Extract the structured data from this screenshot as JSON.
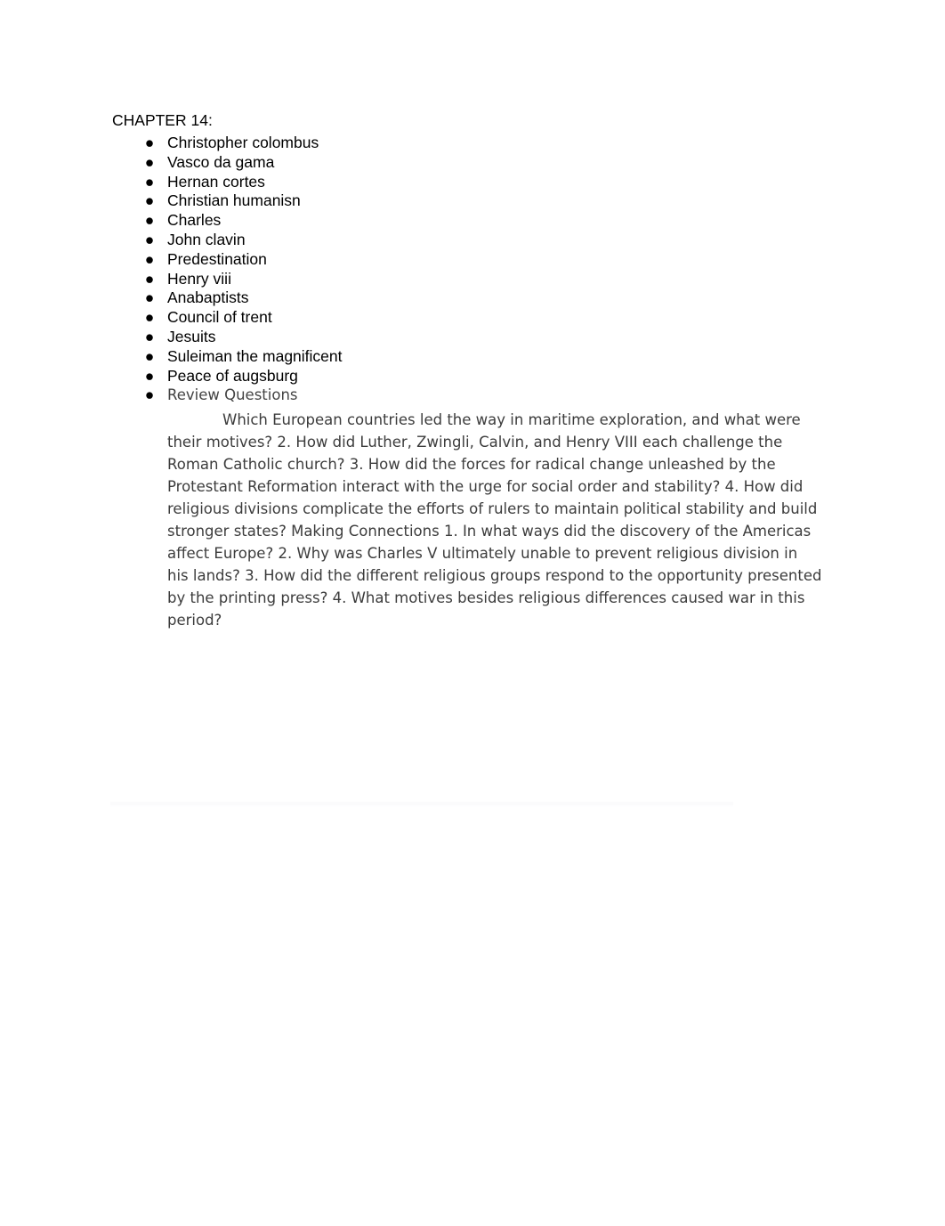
{
  "document": {
    "heading": "CHAPTER 14:",
    "bullet_glyph": "●",
    "terms": [
      {
        "label": "Christopher colombus"
      },
      {
        "label": "Vasco da gama"
      },
      {
        "label": "Hernan cortes"
      },
      {
        "label": "Christian humanisn"
      },
      {
        "label": "Charles"
      },
      {
        "label": "John clavin"
      },
      {
        "label": "Predestination"
      },
      {
        "label": "Henry viii"
      },
      {
        "label": "Anabaptists"
      },
      {
        "label": "Council of trent"
      },
      {
        "label": "Jesuits"
      },
      {
        "label": "Suleiman the magnificent"
      },
      {
        "label": "Peace of augsburg"
      },
      {
        "label": "Review Questions"
      }
    ],
    "paragraph": "Which European countries led the way in maritime exploration, and what were their motives? 2. How did Luther, Zwingli, Calvin, and Henry VIII each challenge the Roman Catholic church? 3. How did the forces for radical change unleashed by the Protestant Reformation interact with the urge for social order and stability? 4. How did religious divisions complicate the efforts of rulers to maintain political stability and build stronger states? Making Connections 1. In what ways did the discovery of the Americas affect Europe? 2. Why was Charles V ultimately unable to prevent religious division in his lands? 3. How did the different religious groups respond to the opportunity presented by the printing press? 4. What motives besides religious differences caused war in this period?",
    "colors": {
      "page_background": "#ffffff",
      "heading_text": "#000000",
      "list_text": "#000000",
      "body_text": "#3c3c3c",
      "last_item_text": "#434343",
      "rule": "#f7f7f9"
    }
  }
}
